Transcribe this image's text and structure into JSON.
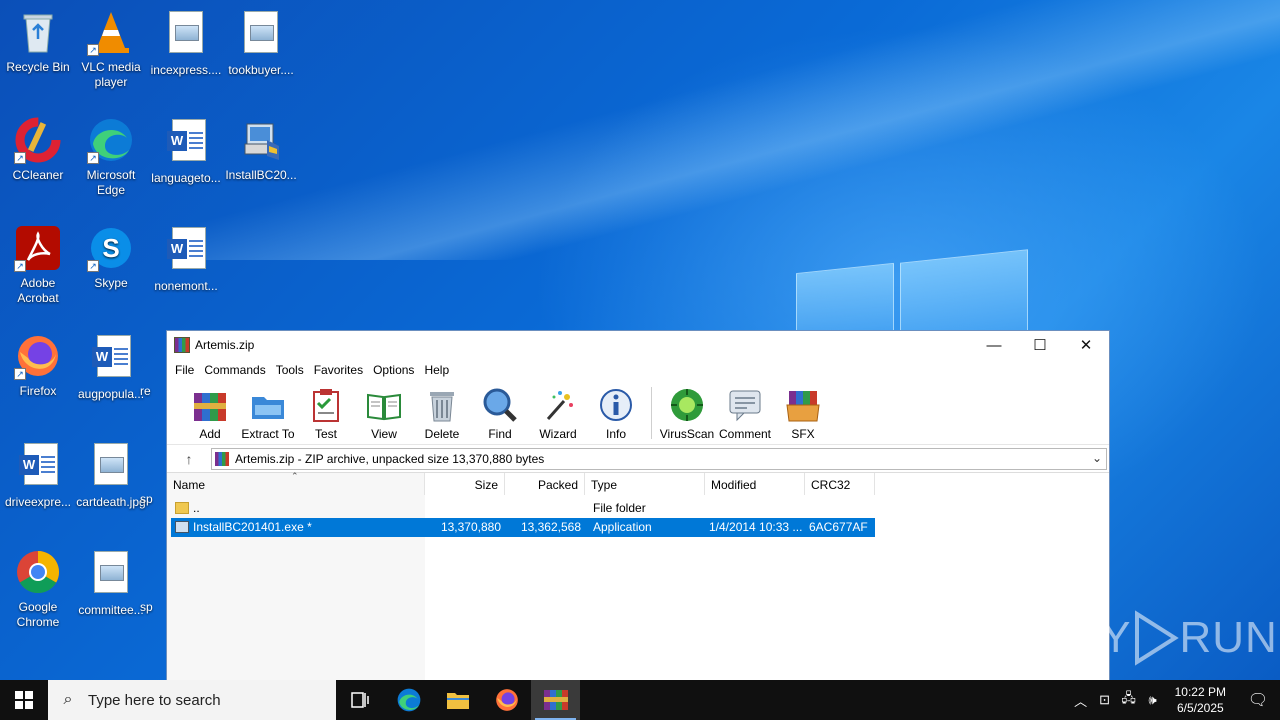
{
  "desktop": {
    "icons": [
      {
        "label": "Recycle Bin"
      },
      {
        "label": "VLC media player"
      },
      {
        "label": "incexpress...."
      },
      {
        "label": "tookbuyer...."
      },
      {
        "label": "CCleaner"
      },
      {
        "label": "Microsoft Edge"
      },
      {
        "label": "languageto..."
      },
      {
        "label": "InstallBC20..."
      },
      {
        "label": "Adobe Acrobat"
      },
      {
        "label": "Skype"
      },
      {
        "label": "nonemont..."
      },
      {
        "label": "Firefox"
      },
      {
        "label": "augpopula..."
      },
      {
        "label": "re"
      },
      {
        "label": "driveexpre..."
      },
      {
        "label": "cartdeath.jpg"
      },
      {
        "label": "sp"
      },
      {
        "label": "Google Chrome"
      },
      {
        "label": "committee..."
      },
      {
        "label": "sp"
      }
    ]
  },
  "window": {
    "title": "Artemis.zip",
    "controls": {
      "minimize": "—",
      "maximize": "☐",
      "close": "✕"
    },
    "menu": [
      "File",
      "Commands",
      "Tools",
      "Favorites",
      "Options",
      "Help"
    ],
    "toolbar": [
      "Add",
      "Extract To",
      "Test",
      "View",
      "Delete",
      "Find",
      "Wizard",
      "Info",
      "VirusScan",
      "Comment",
      "SFX"
    ],
    "address": "Artemis.zip - ZIP archive, unpacked size 13,370,880 bytes",
    "columns": {
      "name": "Name",
      "size": "Size",
      "packed": "Packed",
      "type": "Type",
      "modified": "Modified",
      "crc": "CRC32"
    },
    "rows": [
      {
        "name": "..",
        "size": "",
        "packed": "",
        "type": "File folder",
        "modified": "",
        "crc": ""
      },
      {
        "name": "InstallBC201401.exe *",
        "size": "13,370,880",
        "packed": "13,362,568",
        "type": "Application",
        "modified": "1/4/2014 10:33 ...",
        "crc": "6AC677AF"
      }
    ]
  },
  "watermark": {
    "left": "ANY",
    "right": "RUN"
  },
  "taskbar": {
    "search_placeholder": "Type here to search",
    "time": "10:22 PM",
    "date": "6/5/2025"
  }
}
